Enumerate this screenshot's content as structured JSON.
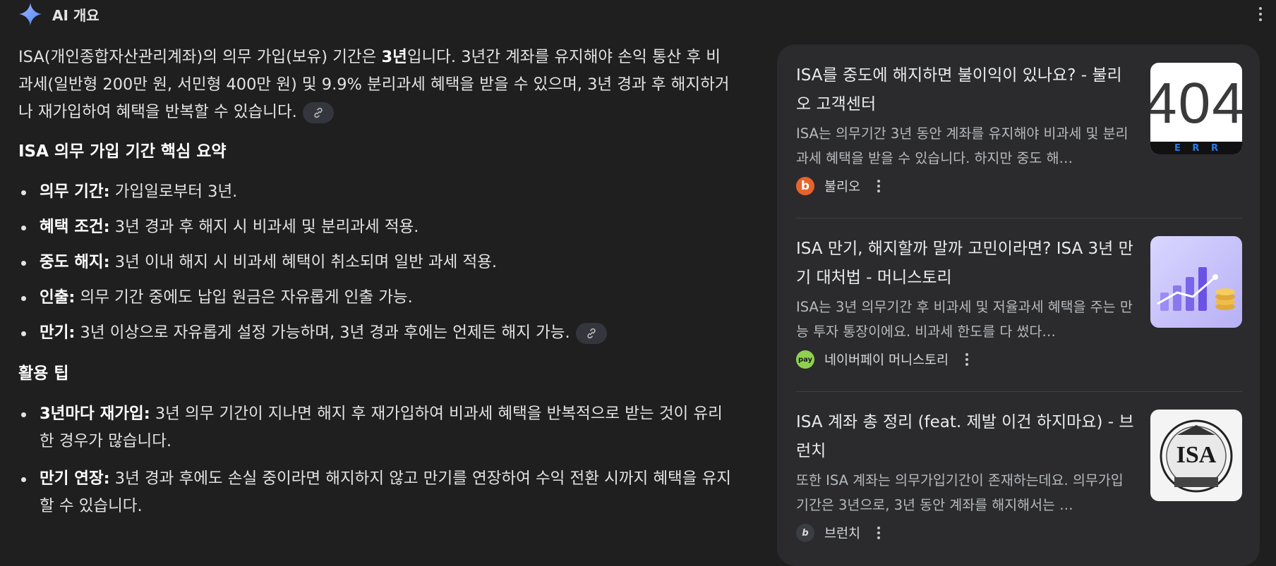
{
  "header": {
    "title": "AI 개요"
  },
  "main": {
    "intro": {
      "part1": "ISA(개인종합자산관리계좌)의 의무 가입(보유) 기간은 ",
      "bold": "3년",
      "part2": "입니다. 3년간 계좌를 유지해야 손익 통산 후 비과세(일반형 200만 원, 서민형 400만 원) 및 9.9% 분리과세 혜택을 받을 수 있으며, 3년 경과 후 해지하거나 재가입하여 혜택을 반복할 수 있습니다."
    },
    "summary_heading": "ISA 의무 가입 기간 핵심 요약",
    "summary_items": [
      {
        "label": "의무 기간:",
        "text": " 가입일로부터 3년."
      },
      {
        "label": "혜택 조건:",
        "text": " 3년 경과 후 해지 시 비과세 및 분리과세 적용."
      },
      {
        "label": "중도 해지:",
        "text": " 3년 이내 해지 시 비과세 혜택이 취소되며 일반 과세 적용."
      },
      {
        "label": "인출:",
        "text": " 의무 기간 중에도 납입 원금은 자유롭게 인출 가능."
      },
      {
        "label": "만기:",
        "text": " 3년 이상으로 자유롭게 설정 가능하며, 3년 경과 후에는 언제든 해지 가능."
      }
    ],
    "tips_heading": "활용 팁",
    "tips_items": [
      {
        "label": "3년마다 재가입:",
        "text": " 3년 의무 기간이 지나면 해지 후 재가입하여 비과세 혜택을 반복적으로 받는 것이 유리한 경우가 많습니다."
      },
      {
        "label": "만기 연장:",
        "text": " 3년 경과 후에도 손실 중이라면 해지하지 않고 만기를 연장하여 수익 전환 시까지 혜택을 유지할 수 있습니다."
      }
    ]
  },
  "sources": [
    {
      "title": "ISA를 중도에 해지하면 불이익이 있나요? - 불리오 고객센터",
      "snippet": "ISA는 의무기간 3년 동안 계좌를 유지해야 비과세 및 분리과세 혜택을 받을 수 있습니다. 하지만 중도 해…",
      "source": "불리오",
      "favicon": "b",
      "thumb_text": "404",
      "thumb_sub": "E R R"
    },
    {
      "title": "ISA 만기, 해지할까 말까 고민이라면? ISA 3년 만기 대처법 - 머니스토리",
      "snippet": "ISA는 3년 의무기간 후 비과세 및 저율과세 혜택을 주는 만능 투자 통장이에요. 비과세 한도를 다 썼다…",
      "source": "네이버페이 머니스토리",
      "favicon": "pay"
    },
    {
      "title": "ISA 계좌 총 정리 (feat. 제발 이건 하지마요) - 브런치",
      "snippet": "또한 ISA 계좌는 의무가입기간이 존재하는데요. 의무가입기간은 3년으로, 3년 동안 계좌를 해지해서는 …",
      "source": "브런치",
      "favicon": "b",
      "thumb_text": "ISA"
    }
  ],
  "colors": {
    "background": "#1f1f1f",
    "panel": "#2b2b2e",
    "text": "#e3e3e3",
    "snippet": "#b6b9bd",
    "bullio_orange": "#e8632b",
    "naverpay_green": "#8fd14f"
  }
}
